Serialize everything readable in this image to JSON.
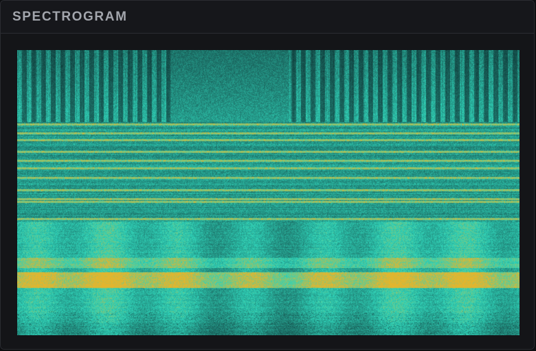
{
  "panel": {
    "title": "SPECTROGRAM"
  },
  "spectrogram": {
    "colormap": {
      "low": "#0f3b3a",
      "mid_low": "#1c6f66",
      "mid": "#2fd2b8",
      "high": "#e2b52e"
    }
  }
}
